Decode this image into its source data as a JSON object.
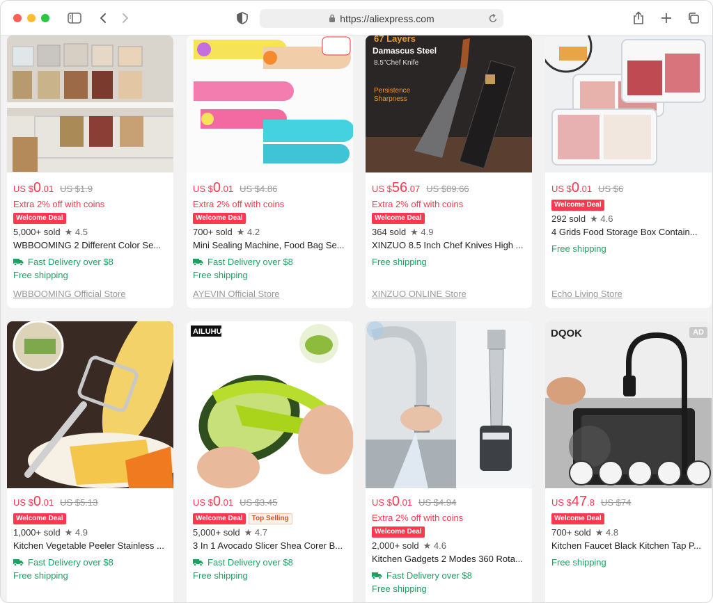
{
  "browser": {
    "url": "https://aliexpress.com"
  },
  "colors": {
    "price": "#fd384f",
    "green": "#1fa062",
    "badge": "#fd384f"
  },
  "products": [
    {
      "currency": "US $",
      "price_main": "0",
      "price_cents": ".01",
      "original": "US $1.9",
      "coins": "Extra 2% off with coins",
      "badges": [
        "Welcome Deal"
      ],
      "sold": "5,000+ sold",
      "rating": "★ 4.5",
      "title": "WBBOOMING 2 Different Color Se...",
      "fast_delivery": "Fast Delivery over $8",
      "free_shipping": "Free shipping",
      "store": "WBBOOMING Official Store"
    },
    {
      "currency": "US $",
      "price_main": "0",
      "price_cents": ".01",
      "original": "US $4.86",
      "coins": "Extra 2% off with coins",
      "badges": [
        "Welcome Deal"
      ],
      "sold": "700+ sold",
      "rating": "★ 4.2",
      "title": "Mini Sealing Machine, Food Bag Se...",
      "fast_delivery": "Fast Delivery over $8",
      "free_shipping": "Free shipping",
      "store": "AYEVIN Official Store"
    },
    {
      "currency": "US $",
      "price_main": "56",
      "price_cents": ".07",
      "original": "US $89.66",
      "coins": "Extra 2% off with coins",
      "badges": [
        "Welcome Deal"
      ],
      "sold": "364 sold",
      "rating": "★ 4.9",
      "title": "XINZUO 8.5 Inch Chef Knives High ...",
      "fast_delivery": "",
      "free_shipping": "Free shipping",
      "store": "XINZUO ONLINE Store",
      "image_text": {
        "l1": "67 Layers",
        "l2": "Damascus Steel",
        "l3": "8.5\"Chef Knife",
        "l4": "Persistence",
        "l5": "Sharpness"
      }
    },
    {
      "currency": "US $",
      "price_main": "0",
      "price_cents": ".01",
      "original": "US $6",
      "coins": "",
      "badges": [
        "Welcome Deal"
      ],
      "sold": "292 sold",
      "rating": "★ 4.6",
      "title": "4 Grids Food Storage Box Contain...",
      "fast_delivery": "",
      "free_shipping": "Free shipping",
      "store": "Echo Living Store"
    },
    {
      "currency": "US $",
      "price_main": "0",
      "price_cents": ".01",
      "original": "US $5.13",
      "coins": "",
      "badges": [
        "Welcome Deal"
      ],
      "sold": "1,000+ sold",
      "rating": "★ 4.9",
      "title": "Kitchen Vegetable Peeler Stainless ...",
      "fast_delivery": "Fast Delivery over $8",
      "free_shipping": "Free shipping",
      "store": ""
    },
    {
      "currency": "US $",
      "price_main": "0",
      "price_cents": ".01",
      "original": "US $3.45",
      "coins": "",
      "badges": [
        "Welcome Deal",
        "Top Selling"
      ],
      "sold": "5,000+ sold",
      "rating": "★ 4.7",
      "title": "3 In 1 Avocado Slicer Shea Corer B...",
      "fast_delivery": "Fast Delivery over $8",
      "free_shipping": "Free shipping",
      "store": "",
      "image_text": {
        "brand": "AILUHU"
      }
    },
    {
      "currency": "US $",
      "price_main": "0",
      "price_cents": ".01",
      "original": "US $4.94",
      "coins": "Extra 2% off with coins",
      "badges": [
        "Welcome Deal"
      ],
      "sold": "2,000+ sold",
      "rating": "★ 4.6",
      "title": "Kitchen Gadgets 2 Modes 360 Rota...",
      "fast_delivery": "Fast Delivery over $8",
      "free_shipping": "Free shipping",
      "store": ""
    },
    {
      "currency": "US $",
      "price_main": "47",
      "price_cents": ".8",
      "original": "US $74",
      "coins": "",
      "badges": [
        "Welcome Deal"
      ],
      "sold": "700+ sold",
      "rating": "★ 4.8",
      "title": "Kitchen Faucet Black Kitchen Tap P...",
      "fast_delivery": "",
      "free_shipping": "Free shipping",
      "store": "",
      "image_text": {
        "brand": "DQOK",
        "ad": "AD"
      }
    }
  ]
}
